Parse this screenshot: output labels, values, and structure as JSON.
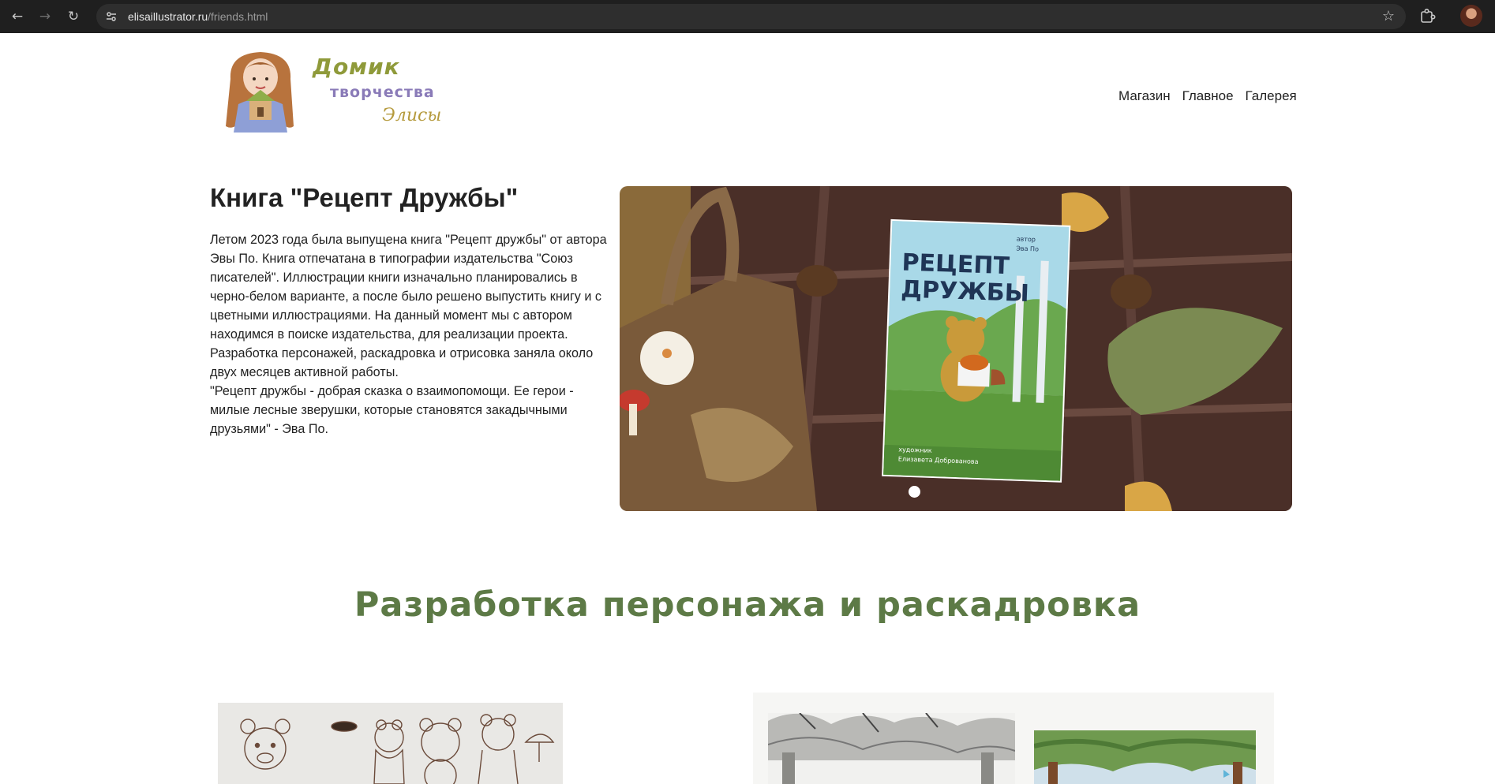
{
  "browser": {
    "url_domain": "elisaillustrator.ru",
    "url_path": "/friends.html",
    "back_icon": "arrow-left-icon",
    "forward_icon": "arrow-right-icon",
    "reload_icon": "reload-icon",
    "bookmark_icon": "star-icon",
    "extensions_icon": "puzzle-icon"
  },
  "logo": {
    "word1": "Домик",
    "word2": "творчества",
    "word3": "Элисы"
  },
  "nav": {
    "items": [
      "Магазин",
      "Главное",
      "Галерея"
    ]
  },
  "book": {
    "title": "Книга \"Рецепт Дружбы\"",
    "paragraphs": [
      "Летом 2023 года была выпущена книга \"Рецепт дружбы\" от автора Эвы По. Книга отпечатана в типографии издательства \"Союз писателей\". Иллюстрации книги изначально планировались в черно-белом варианте, а после было решено выпустить книгу и с цветными иллюстрациями. На данный момент мы с автором находимся в поиске издательства, для реализации проекта.",
      "Разработка персонажей, раскадровка и отрисовка заняла около двух месяцев активной работы.",
      "\"Рецепт дружбы - добрая сказка о взаимопомощи. Ее герои - милые лесные зверушки, которые становятся закадычными друзьями\" - Эва По."
    ],
    "cover": {
      "title_line1": "РЕЦЕПТ",
      "title_line2": "ДРУЖБЫ",
      "author_label": "автор",
      "author_name": "Эва По",
      "artist_label": "художник",
      "artist_name": "Елизавета Доброванова"
    },
    "colors": {
      "blanket": "#4a2f28",
      "bag": "#7a5a3a",
      "grass": "#8a6a3a"
    }
  },
  "section": {
    "title": "Разработка персонажа и раскадровка"
  }
}
